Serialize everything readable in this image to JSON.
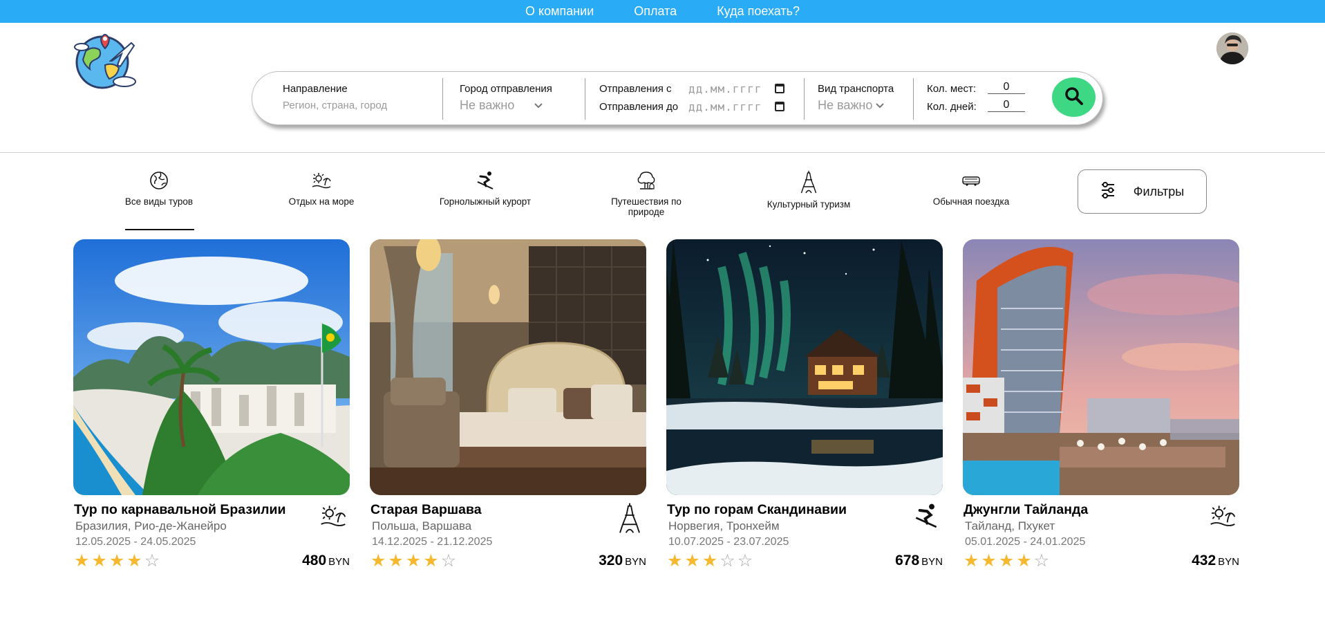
{
  "topnav": [
    "О компании",
    "Оплата",
    "Куда поехать?"
  ],
  "search": {
    "direction_label": "Направление",
    "direction_placeholder": "Регион, страна, город",
    "departure_city_label": "Город отправления",
    "departure_city_value": "Не важно",
    "date_from_label": "Отправления с",
    "date_to_label": "Отправления до",
    "date_placeholder": "дд.мм.гггг",
    "transport_label": "Вид транспорта",
    "transport_value": "Не важно",
    "seats_label": "Кол. мест:",
    "seats_value": "0",
    "days_label": "Кол. дней:",
    "days_value": "0"
  },
  "categories": [
    {
      "label": "Все виды туров",
      "icon": "globe-icon"
    },
    {
      "label": "Отдых на море",
      "icon": "beach-icon"
    },
    {
      "label": "Горнолыжный курорт",
      "icon": "skier-icon"
    },
    {
      "label": "Путешествия по природе",
      "icon": "nature-icon"
    },
    {
      "label": "Культурный туризм",
      "icon": "eiffel-tower-icon"
    },
    {
      "label": "Обычная поездка",
      "icon": "bus-icon"
    }
  ],
  "filters_label": "Фильтры",
  "colors": {
    "topbar": "#29abf5",
    "search_button": "#3ed884",
    "star": "#f5b82e"
  },
  "tours": [
    {
      "title": "Тур по карнавальной Бразилии",
      "place": "Бразилия, Рио-де-Жанейро",
      "dates": "12.05.2025 - 24.05.2025",
      "rating": 4,
      "price": "480",
      "currency": "BYN",
      "type_icon": "beach-icon"
    },
    {
      "title": "Старая Варшава",
      "place": "Польша, Варшава",
      "dates": "14.12.2025 - 21.12.2025",
      "rating": 4,
      "price": "320",
      "currency": "BYN",
      "type_icon": "eiffel-tower-icon"
    },
    {
      "title": "Тур по горам Скандинавии",
      "place": "Норвегия, Тронхейм",
      "dates": "10.07.2025 - 23.07.2025",
      "rating": 3,
      "price": "678",
      "currency": "BYN",
      "type_icon": "skier-icon"
    },
    {
      "title": "Джунгли Тайланда",
      "place": "Тайланд, Пхукет",
      "dates": "05.01.2025 - 24.01.2025",
      "rating": 4,
      "price": "432",
      "currency": "BYN",
      "type_icon": "beach-icon"
    }
  ]
}
